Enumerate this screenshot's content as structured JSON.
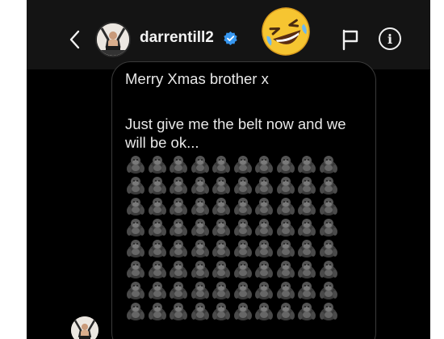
{
  "header": {
    "username": "darrentill2",
    "back_icon": "chevron-left-icon",
    "verified_icon": "verified-badge-icon",
    "flag_icon": "flag-icon",
    "info_icon": "info-icon",
    "info_glyph": "i",
    "overlay_emoji": "rolling-on-floor-laughing-emoji",
    "verified_color": "#3797f0"
  },
  "message": {
    "greeting": "Merry Xmas brother x",
    "body": "Just give me the belt now and we will be ok...",
    "emoji_icon": "gorilla-icon",
    "emoji_count": 80
  },
  "colors": {
    "background": "#000000",
    "header": "#141414",
    "bubble_border": "#3a3a3a",
    "text": "#e8e8e8"
  }
}
